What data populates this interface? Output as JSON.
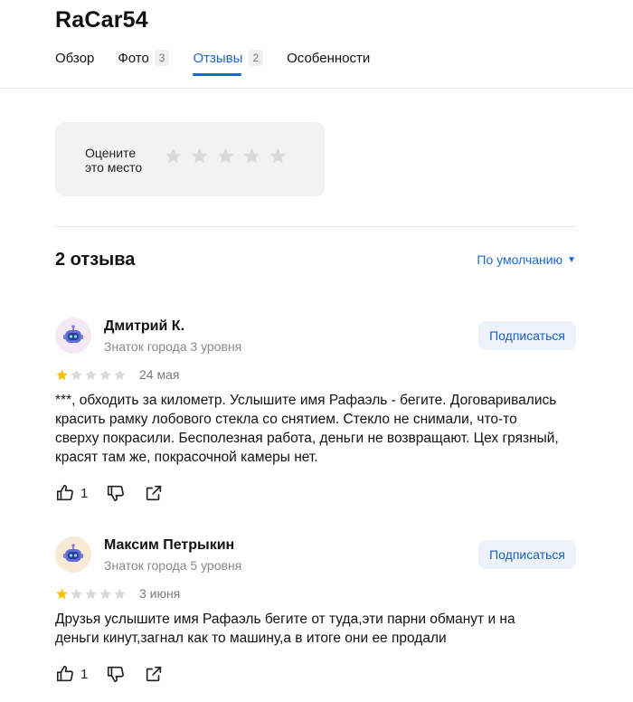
{
  "header": {
    "title": "RaCar54"
  },
  "tabs": [
    {
      "label": "Обзор",
      "count": ""
    },
    {
      "label": "Фото",
      "count": "3"
    },
    {
      "label": "Отзывы",
      "count": "2"
    },
    {
      "label": "Особенности",
      "count": ""
    }
  ],
  "active_tab": "Отзывы",
  "rate": {
    "label": "Оцените это место",
    "stars": 5
  },
  "reviews_heading": "2 отзыва",
  "sort_label": "По умолчанию",
  "colors": {
    "accent": "#1a66d6",
    "star_filled": "#f7c100",
    "star_empty": "#d9d9d9"
  },
  "reviews": [
    {
      "author": "Дмитрий К.",
      "level": "Знаток города 3 уровня",
      "subscribe_label": "Подписаться",
      "rating": 1,
      "date": "24 мая",
      "text": "***, обходить за километр. Услышите имя Рафаэль - бегите. Договаривались красить рамку лобового стекла со снятием. Стекло не снимали, что-то сверху покрасили. Бесполезная работа, деньги не возвращают. Цех грязный, красят там же, покрасочной камеры нет.",
      "likes": "1",
      "avatar_bg": "#f3e8f3"
    },
    {
      "author": "Максим Петрыкин",
      "level": "Знаток города 5 уровня",
      "subscribe_label": "Подписаться",
      "rating": 1,
      "date": "3 июня",
      "text": "Друзья услышите имя Рафаэль бегите от туда,эти парни обманут и на деньги кинут,загнал как то машину,а в итоге они ее продали",
      "likes": "1",
      "avatar_bg": "#f8ead4"
    }
  ]
}
